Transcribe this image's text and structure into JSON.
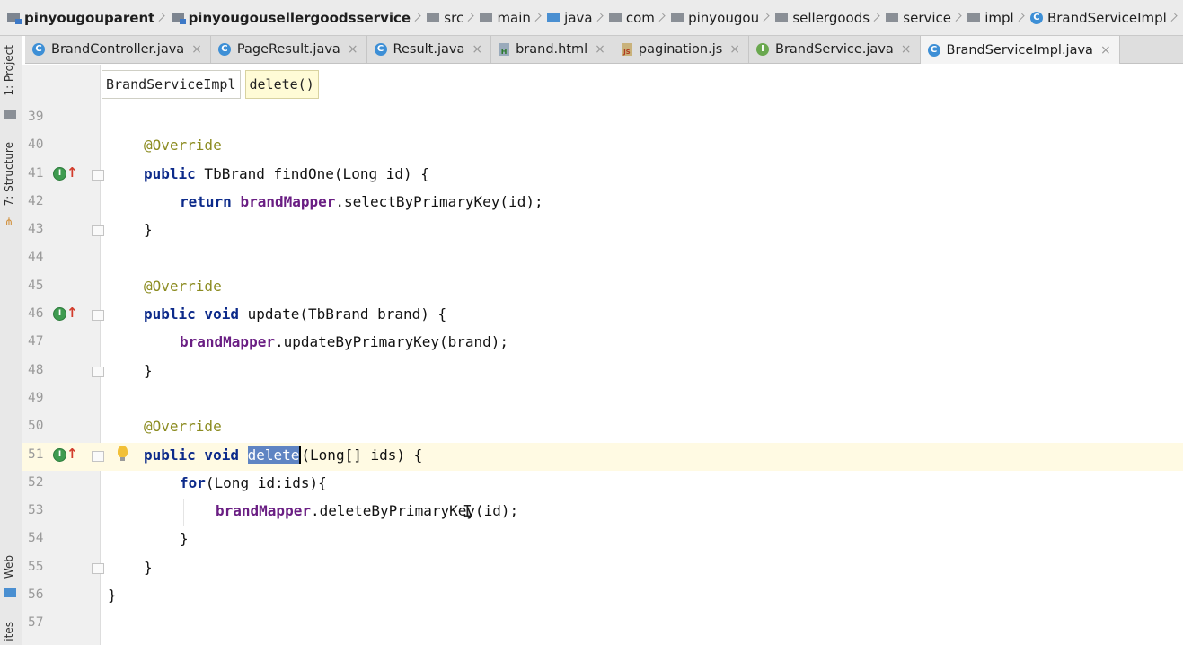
{
  "breadcrumb": {
    "items": [
      {
        "label": "pinyougouparent",
        "icon": "module-folder-icon"
      },
      {
        "label": "pinyougousellergoodsservice",
        "icon": "module-folder-icon"
      },
      {
        "label": "src",
        "icon": "folder-icon"
      },
      {
        "label": "main",
        "icon": "folder-icon"
      },
      {
        "label": "java",
        "icon": "source-folder-icon"
      },
      {
        "label": "com",
        "icon": "package-icon"
      },
      {
        "label": "pinyougou",
        "icon": "package-icon"
      },
      {
        "label": "sellergoods",
        "icon": "package-icon"
      },
      {
        "label": "service",
        "icon": "package-icon"
      },
      {
        "label": "impl",
        "icon": "package-icon"
      },
      {
        "label": "BrandServiceImpl",
        "icon": "class-icon"
      }
    ]
  },
  "tabs": [
    {
      "label": "BrandController.java",
      "icon": "C",
      "active": false
    },
    {
      "label": "PageResult.java",
      "icon": "C",
      "active": false
    },
    {
      "label": "Result.java",
      "icon": "C",
      "active": false
    },
    {
      "label": "brand.html",
      "icon": "H",
      "active": false
    },
    {
      "label": "pagination.js",
      "icon": "JS",
      "active": false
    },
    {
      "label": "BrandService.java",
      "icon": "I",
      "active": false
    },
    {
      "label": "BrandServiceImpl.java",
      "icon": "C",
      "active": true
    }
  ],
  "tool_strip": {
    "project": "1: Project",
    "structure": "7: Structure",
    "web": "Web",
    "favorites": "ites"
  },
  "method_breadcrumb": {
    "class_name": "BrandServiceImpl",
    "method_name": "delete()"
  },
  "editor": {
    "line_numbers": [
      "39",
      "40",
      "41",
      "42",
      "43",
      "44",
      "45",
      "46",
      "47",
      "48",
      "49",
      "50",
      "51",
      "52",
      "53",
      "54",
      "55",
      "56",
      "57"
    ],
    "code": {
      "l40_ann": "@Override",
      "l41_kw": "public",
      "l41_rest": " TbBrand findOne(Long id) {",
      "l42_kw": "return",
      "l42_field": "brandMapper",
      "l42_rest": ".selectByPrimaryKey(id);",
      "l43": "}",
      "l45_ann": "@Override",
      "l46_kw": "public void",
      "l46_rest": " update(TbBrand brand) {",
      "l47_field": "brandMapper",
      "l47_rest": ".updateByPrimaryKey(brand);",
      "l48": "}",
      "l50_ann": "@Override",
      "l51_kw": "public void",
      "l51_sel": "delete",
      "l51_rest": "(Long[] ids) {",
      "l52_kw": "for",
      "l52_rest": "(Long id:ids){",
      "l53_field": "brandMapper",
      "l53_rest": ".deleteByPrimaryKey(id);",
      "l54": "}",
      "l55": "}",
      "l56": "}"
    }
  },
  "colors": {
    "keyword": "#0c2a8a",
    "annotation": "#8c8c21",
    "field": "#6a1e83",
    "selection": "#5f84c3",
    "current_line": "#fffae3"
  }
}
